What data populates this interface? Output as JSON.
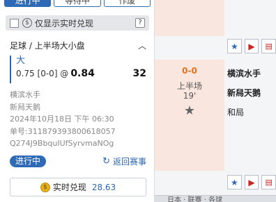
{
  "tabs": [
    {
      "label": "进行中",
      "active": true
    },
    {
      "label": "等待中",
      "active": false
    },
    {
      "label": "作废",
      "active": false
    }
  ],
  "filter": {
    "label": "仅显示实时兑现",
    "help": "?"
  },
  "bet": {
    "market": "足球 / 上半场大小盘",
    "selection": "大",
    "line": "0.75 [0-0] @",
    "odds": "0.84",
    "stake": "32",
    "home": "横滨水手",
    "away": "新舄天鹅",
    "time": "2024年10月18日 下午 06:30",
    "order_no": "单号:311879393800618057",
    "code": "Q274J9BbquIUfSyrvmaNOg",
    "status": "进行中",
    "back_label": "返回赛事"
  },
  "cashout": {
    "label": "实时兑现",
    "amount": "28.63"
  },
  "match": {
    "score": "0-0",
    "period": "上半场",
    "minute": "19'",
    "selections": [
      "横滨水手",
      "新舄天鹅",
      "和局"
    ]
  },
  "bottom_bar": {
    "text": "日本 · 联赛 · 各球"
  },
  "colors": {
    "accent": "#2e6ab5",
    "score": "#e0721e",
    "coin": "#e7b21d",
    "peach": "#f8e6df"
  }
}
